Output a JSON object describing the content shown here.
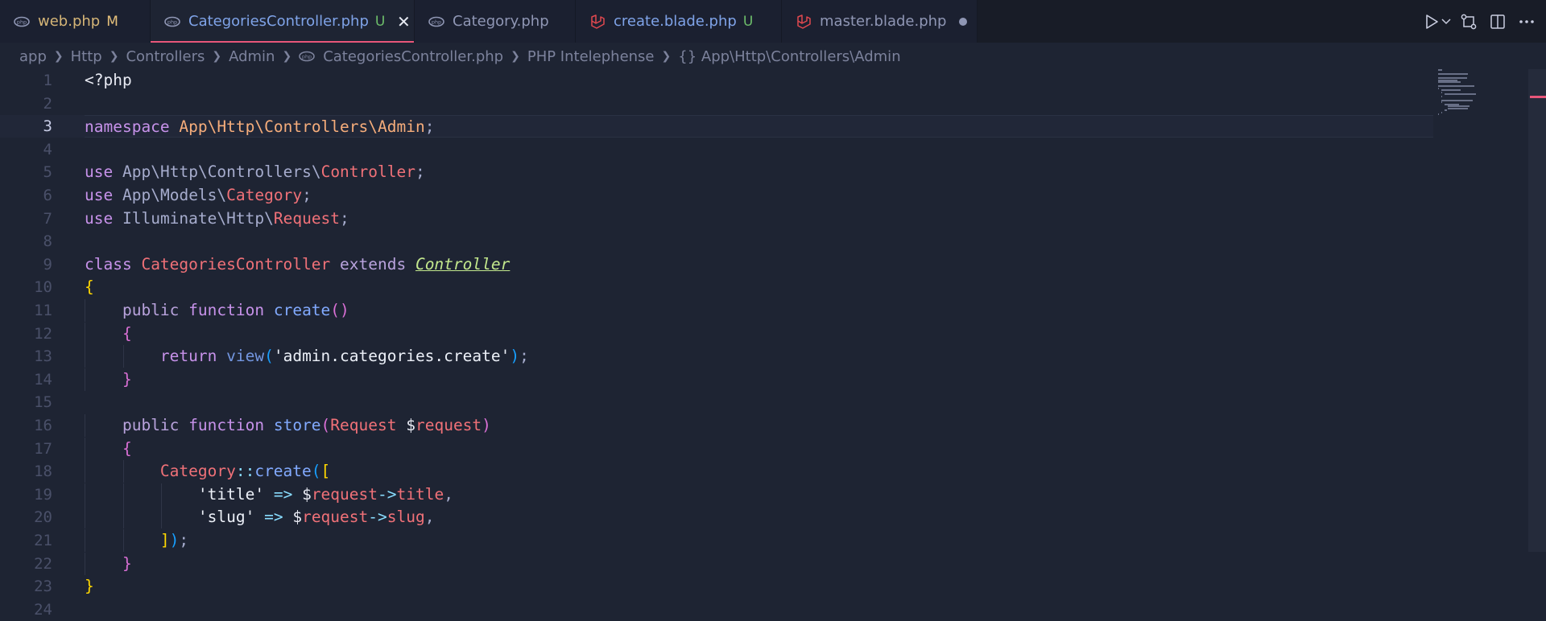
{
  "tabs": [
    {
      "label": "web.php",
      "status": "M",
      "icon": "php-icon"
    },
    {
      "label": "CategoriesController.php",
      "status": "U",
      "icon": "php-icon",
      "active": true
    },
    {
      "label": "Category.php",
      "status": "",
      "icon": "php-icon"
    },
    {
      "label": "create.blade.php",
      "status": "U",
      "icon": "laravel-icon"
    },
    {
      "label": "master.blade.php",
      "status": "",
      "icon": "laravel-icon",
      "unsaved": true
    }
  ],
  "breadcrumb": {
    "items": [
      "app",
      "Http",
      "Controllers",
      "Admin",
      "CategoriesController.php",
      "PHP Intelephense",
      "{} App\\Http\\Controllers\\Admin"
    ]
  },
  "editor": {
    "current_line": 3,
    "line_numbers": [
      "1",
      "2",
      "3",
      "4",
      "5",
      "6",
      "7",
      "8",
      "9",
      "10",
      "11",
      "12",
      "13",
      "14",
      "15",
      "16",
      "17",
      "18",
      "19",
      "20",
      "21",
      "22",
      "23",
      "24"
    ],
    "lines": [
      "<?php",
      "",
      "namespace App\\Http\\Controllers\\Admin;",
      "",
      "use App\\Http\\Controllers\\Controller;",
      "use App\\Models\\Category;",
      "use Illuminate\\Http\\Request;",
      "",
      "class CategoriesController extends Controller",
      "{",
      "    public function create()",
      "    {",
      "        return view('admin.categories.create');",
      "    }",
      "",
      "    public function store(Request $request)",
      "    {",
      "        Category::create([",
      "            'title' => $request->title,",
      "            'slug' => $request->slug,",
      "        ]);",
      "    }",
      "}",
      ""
    ]
  },
  "colors": {
    "background": "#1e2433",
    "tabbar": "#181c27",
    "active_tab_accent": "#e8567a",
    "keyword": "#c792ea",
    "namespace": "#f6ad7b",
    "class": "#f07178",
    "function": "#82aaff",
    "untracked": "#6dbd6a",
    "modified": "#e5c07b"
  },
  "icons": [
    "php-icon",
    "laravel-icon",
    "close-icon",
    "run-icon",
    "chevron-down-icon",
    "source-control-icon",
    "split-editor-icon",
    "more-icon"
  ]
}
